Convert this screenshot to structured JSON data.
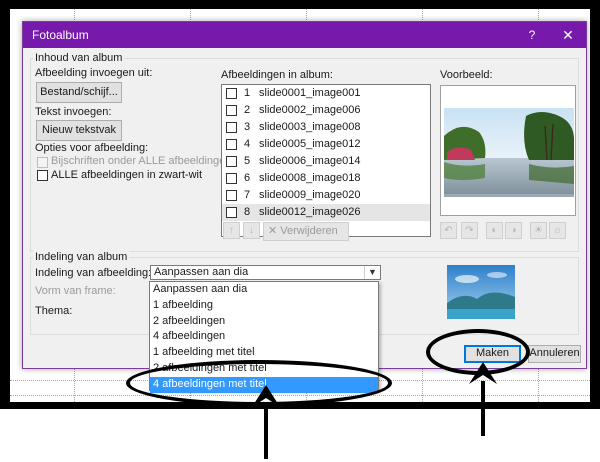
{
  "dialog": {
    "title": "Fotoalbum",
    "help_label": "?",
    "close_label": "✕",
    "titlebar_color": "#7719aa"
  },
  "album_content": {
    "group_label": "Inhoud van album",
    "insert_picture_label": "Afbeelding invoegen uit:",
    "file_disk_button": "Bestand/schijf...",
    "insert_text_label": "Tekst invoegen:",
    "new_textbox_button": "Nieuw tekstvak",
    "picture_options_label": "Opties voor afbeelding:",
    "captions_option": "Bijschriften onder ALLE afbeeldingen",
    "black_white_option": "ALLE afbeeldingen in zwart-wit",
    "pictures_in_album_label": "Afbeeldingen in album:",
    "preview_label": "Voorbeeld:",
    "remove_button": "Verwijderen",
    "items": [
      {
        "num": "1",
        "name": "slide0001_image001"
      },
      {
        "num": "2",
        "name": "slide0002_image006"
      },
      {
        "num": "3",
        "name": "slide0003_image008"
      },
      {
        "num": "4",
        "name": "slide0005_image012"
      },
      {
        "num": "5",
        "name": "slide0006_image014"
      },
      {
        "num": "6",
        "name": "slide0008_image018"
      },
      {
        "num": "7",
        "name": "slide0009_image020"
      },
      {
        "num": "8",
        "name": "slide0012_image026"
      }
    ]
  },
  "album_layout": {
    "group_label": "Indeling van album",
    "picture_layout_label": "Indeling van afbeelding:",
    "picture_layout_value": "Aanpassen aan dia",
    "frame_shape_label": "Vorm van frame:",
    "theme_label": "Thema:",
    "options": [
      "Aanpassen aan dia",
      "1 afbeelding",
      "2 afbeeldingen",
      "4 afbeeldingen",
      "1 afbeelding met titel",
      "2 afbeeldingen met titel",
      "4 afbeeldingen met titel"
    ],
    "highlighted_option": "4 afbeeldingen met titel",
    "highlight_color": "#3399ff"
  },
  "footer": {
    "create_button": "Maken",
    "cancel_button": "Annuleren"
  }
}
